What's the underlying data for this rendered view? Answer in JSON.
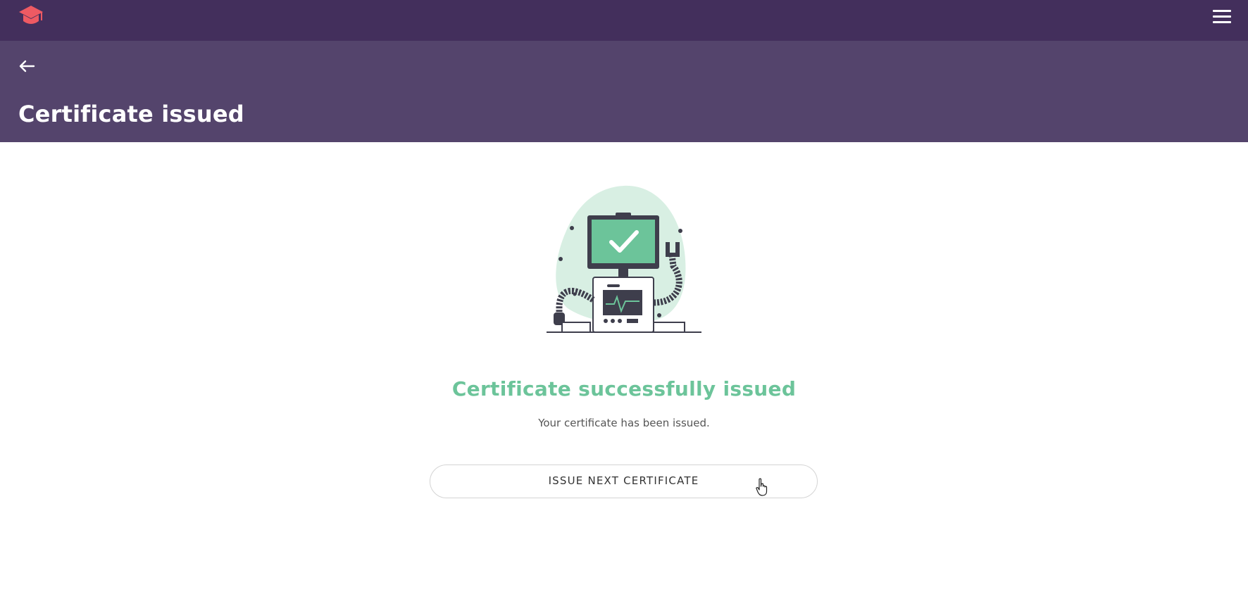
{
  "topbar": {
    "logo_icon": "graduation-cap-icon",
    "menu_icon": "hamburger-menu-icon",
    "brand_color": "#432f5c",
    "logo_color": "#ee5a63"
  },
  "header": {
    "back_icon": "arrow-left-icon",
    "title": "Certificate issued",
    "background": "#54446c"
  },
  "main": {
    "illustration": "computer-checkmark-illustration",
    "success_title": "Certificate successfully issued",
    "success_text": "Your certificate has been issued.",
    "next_button_label": "ISSUE NEXT CERTIFICATE",
    "accent_color": "#6cc49a"
  }
}
